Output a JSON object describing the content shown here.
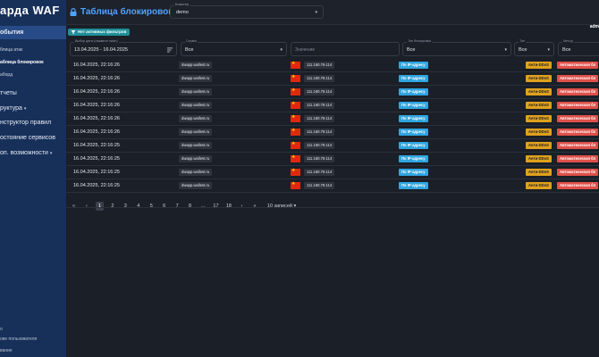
{
  "sidebar": {
    "brand": "арда WAF",
    "items": [
      {
        "label": "обытия"
      },
      {
        "label": "блица атак"
      },
      {
        "label": "аблица блокировок"
      },
      {
        "label": "аборд"
      },
      {
        "label": "тчеты"
      },
      {
        "label": "руктура"
      },
      {
        "label": "нструктор правил"
      },
      {
        "label": "остояние сервисов"
      },
      {
        "label": "оп. возможности"
      }
    ],
    "bottom": [
      {
        "label": "о"
      },
      {
        "label": "ове пользователя"
      },
      {
        "label": "вание"
      }
    ]
  },
  "header": {
    "title": "Таблица блокировок",
    "cluster_label": "Кластер",
    "cluster_value": "demo",
    "corner": "adm"
  },
  "chip": {
    "label": "Нет активных фильтров"
  },
  "filters": {
    "date": {
      "label": "Выбор даты (нажмите ниже)",
      "value": "13.04.2025 - 16.04.2025"
    },
    "service": {
      "label": "Сервис",
      "value": "Все"
    },
    "value": {
      "placeholder": "Значение"
    },
    "block_type": {
      "label": "Тип блокировки",
      "value": "Все"
    },
    "type": {
      "label": "Тип",
      "value": "Все"
    },
    "method": {
      "label": "Метод",
      "value": "Все"
    }
  },
  "rows": [
    {
      "date": "16.04.2025, 22:16:26",
      "domain": "dwapp.wallest.ru",
      "ip": "111.160.79.114",
      "block_type": "По IP-адресу",
      "attack": "Анти-DDoS",
      "method": "Автоматическая бл"
    },
    {
      "date": "16.04.2025, 22:16:26",
      "domain": "dwapp.wallest.ru",
      "ip": "111.160.79.114",
      "block_type": "По IP-адресу",
      "attack": "Анти-DDoS",
      "method": "Автоматическая бл"
    },
    {
      "date": "16.04.2025, 22:16:26",
      "domain": "dwapp.wallest.ru",
      "ip": "111.160.79.114",
      "block_type": "По IP-адресу",
      "attack": "Анти-DDoS",
      "method": "Автоматическая бл"
    },
    {
      "date": "16.04.2025, 22:16:26",
      "domain": "dwapp.wallest.ru",
      "ip": "111.160.79.114",
      "block_type": "По IP-адресу",
      "attack": "Анти-DDoS",
      "method": "Автоматическая бл"
    },
    {
      "date": "16.04.2025, 22:16:26",
      "domain": "dwapp.wallest.ru",
      "ip": "111.160.79.114",
      "block_type": "По IP-адресу",
      "attack": "Анти-DDoS",
      "method": "Автоматическая бл"
    },
    {
      "date": "16.04.2025, 22:16:26",
      "domain": "dwapp.wallest.ru",
      "ip": "111.160.79.114",
      "block_type": "По IP-адресу",
      "attack": "Анти-DDoS",
      "method": "Автоматическая бл"
    },
    {
      "date": "16.04.2025, 22:16:25",
      "domain": "dwapp.wallest.ru",
      "ip": "111.160.79.114",
      "block_type": "По IP-адресу",
      "attack": "Анти-DDoS",
      "method": "Автоматическая бл"
    },
    {
      "date": "16.04.2025, 22:16:25",
      "domain": "dwapp.wallest.ru",
      "ip": "111.160.79.114",
      "block_type": "По IP-адресу",
      "attack": "Анти-DDoS",
      "method": "Автоматическая бл"
    },
    {
      "date": "16.04.2025, 22:16:25",
      "domain": "dwapp.wallest.ru",
      "ip": "111.160.79.114",
      "block_type": "По IP-адресу",
      "attack": "Анти-DDoS",
      "method": "Автоматическая бл"
    },
    {
      "date": "16.04.2025, 22:16:25",
      "domain": "dwapp.wallest.ru",
      "ip": "111.160.79.114",
      "block_type": "По IP-адресу",
      "attack": "Анти-DDoS",
      "method": "Автоматическая бл"
    }
  ],
  "pagination": {
    "first": "«",
    "prev": "‹",
    "pages": [
      "1",
      "2",
      "3",
      "4",
      "5",
      "6",
      "7",
      "8",
      "...",
      "17",
      "18"
    ],
    "active_page": "1",
    "next": "›",
    "last": "»",
    "page_size": "10 записей ▾"
  },
  "colors": {
    "sidebar_bg": "#17305a",
    "accent_blue": "#4fa3ff",
    "chip_teal": "#1f8f9a",
    "badge_ip_blue": "#2fa6e0",
    "badge_ddos_orange": "#e0a11b",
    "badge_method_red": "#e0504a",
    "flag_red": "#de2910"
  }
}
